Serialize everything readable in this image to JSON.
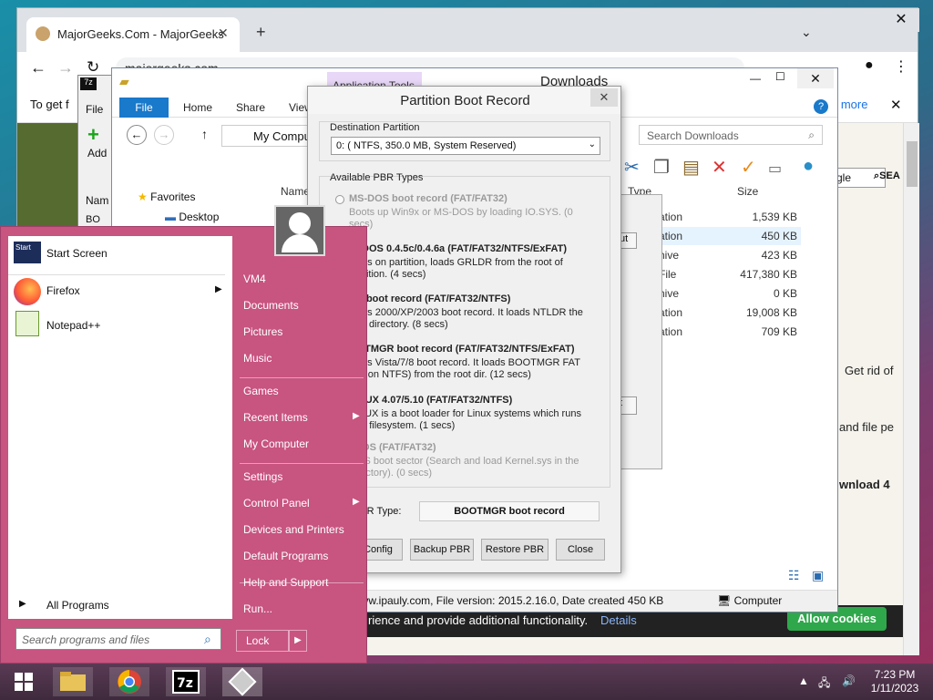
{
  "chrome": {
    "tab_title": "MajorGeeks.Com - MajorGeeks",
    "tab_close": "✕",
    "new_tab": "+",
    "url": "majorgeeks.com",
    "infobar_text": "To get f",
    "infobar_link": "n more",
    "search_text": "gle",
    "search_label": "SEA",
    "right_text_1": "Get rid of",
    "right_text_2": "and file pe",
    "right_text_3": "wnload 4",
    "cookie_text": "rience and provide additional functionality.",
    "cookie_details": "Details",
    "allow_cookies": "Allow cookies"
  },
  "sevenzip": {
    "file": "File",
    "add": "Add",
    "name_col": "Nam",
    "row": "BO"
  },
  "explorer": {
    "app_tools": "Application Tools",
    "title": "Downloads",
    "ribbon_file": "File",
    "ribbon_tabs": [
      "Home",
      "Share",
      "View"
    ],
    "address": "My Compu",
    "search_placeholder": "Search Downloads",
    "nav_favorites": "Favorites",
    "nav_desktop": "Desktop",
    "col_name": "Name",
    "col_type": "Type",
    "col_size": "Size",
    "rows": [
      {
        "type": "ation",
        "size": "1,539 KB"
      },
      {
        "type": "ation",
        "size": "450 KB"
      },
      {
        "type": "hive",
        "size": "423 KB"
      },
      {
        "type": "File",
        "size": "417,380 KB"
      },
      {
        "type": "hive",
        "size": "0 KB"
      },
      {
        "type": "ation",
        "size": "19,008 KB"
      },
      {
        "type": "ation",
        "size": "709 KB"
      }
    ],
    "status_info": "www.ipauly.com, File version: 2015.2.16.0, Date created 450 KB",
    "status_computer": "Computer",
    "mini_btn_1": "ut",
    "mini_btn_2": "t"
  },
  "pbr": {
    "title": "Partition Boot Record",
    "close": "✕",
    "dest_label": "Destination Partition",
    "dest_value": "0: ( NTFS, 350.0 MB, System Reserved)",
    "avail_label": "Available PBR Types",
    "types": [
      {
        "label": "MS-DOS boot record (FAT/FAT32)",
        "desc": "Boots up Win9x or MS-DOS by loading IO.SYS. (0 secs)"
      },
      {
        "label": "B4DOS 0.4.5c/0.4.6a (FAT/FAT32/NTFS/ExFAT)",
        "desc": "4Dos on partition, loads GRLDR from the root of partition. (4 secs)"
      },
      {
        "label": "DR boot record (FAT/FAT32/NTFS)",
        "desc": "dows 2000/XP/2003 boot record. It loads NTLDR the root directory. (8 secs)"
      },
      {
        "label": "OOTMGR boot record (FAT/FAT32/NTFS/ExFAT)",
        "desc": "dows Vista/7/8 boot record. It loads BOOTMGR FAT first on NTFS) from the root dir. (12 secs)"
      },
      {
        "label": "LINUX 4.07/5.10 (FAT/FAT32/NTFS)",
        "desc": "LINUX is a boot loader for Linux systems which runs FAT filesystem. (1 secs)"
      },
      {
        "label": "eDOS (FAT/FAT32)",
        "desc": "DOS boot sector (Search and load Kernel.sys in the directory). (0 secs)"
      }
    ],
    "current_label": "PBR Type:",
    "current_value": "BOOTMGR boot record",
    "btn_config": "Config",
    "btn_backup": "Backup PBR",
    "btn_restore": "Restore PBR",
    "btn_close": "Close"
  },
  "startmenu": {
    "pinned": [
      {
        "label": "Start Screen"
      },
      {
        "label": "Firefox"
      },
      {
        "label": "Notepad++"
      }
    ],
    "all_programs": "All Programs",
    "search_placeholder": "Search programs and files",
    "right_items": [
      "VM4",
      "Documents",
      "Pictures",
      "Music",
      "Games",
      "Recent Items",
      "My Computer",
      "Settings",
      "Control Panel",
      "Devices and Printers",
      "Default Programs",
      "Help and Support",
      "Run..."
    ],
    "lock": "Lock",
    "start_tile_text": "Start"
  },
  "taskbar": {
    "time": "7:23 PM",
    "date": "1/11/2023"
  },
  "colors": {
    "start_bg": "#c85480",
    "explorer_blue": "#1979ca",
    "allow_green": "#2ea84a"
  }
}
